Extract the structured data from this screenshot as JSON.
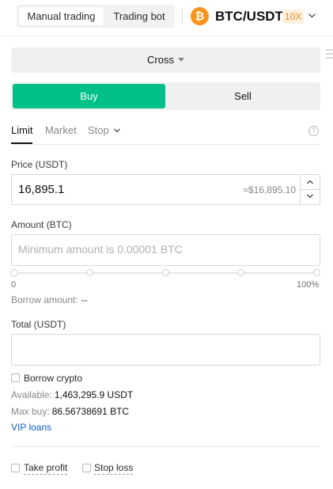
{
  "header": {
    "mode_tabs": [
      "Manual trading",
      "Trading bot"
    ],
    "pair": "BTC/USDT",
    "leverage": "10X",
    "coin_glyph": "₿",
    "icons": [
      "bitcoin-icon",
      "chevron-down-icon"
    ]
  },
  "margin_mode": "Cross",
  "side": {
    "buy_label": "Buy",
    "sell_label": "Sell",
    "buy_color": "#00c087"
  },
  "order_types": [
    "Limit",
    "Market",
    "Stop"
  ],
  "help_glyph": "?",
  "price": {
    "label": "Price (USDT)",
    "value": "16,895.1",
    "usd_equiv": "≈$16,895.10"
  },
  "amount": {
    "label": "Amount (BTC)",
    "placeholder": "Minimum amount is 0.00001 BTC",
    "slider_min": "0",
    "slider_max": "100%",
    "slider_value": 0
  },
  "borrow_amount": {
    "label": "Borrow amount:",
    "value": "--"
  },
  "total": {
    "label": "Total (USDT)",
    "value": ""
  },
  "borrow_crypto": {
    "label": "Borrow crypto",
    "checked": false
  },
  "available": {
    "label": "Available:",
    "value": "1,463,295.9 USDT"
  },
  "max_buy": {
    "label": "Max buy:",
    "value": "86.56738691 BTC"
  },
  "vip_link": "VIP loans",
  "take_profit": {
    "label": "Take profit",
    "checked": false
  },
  "stop_loss": {
    "label": "Stop loss",
    "checked": false
  }
}
